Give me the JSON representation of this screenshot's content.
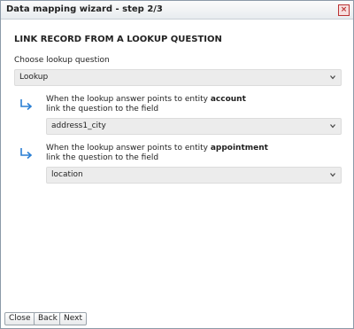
{
  "window": {
    "title": "Data mapping wizard - step 2/3",
    "close_label": "×"
  },
  "main": {
    "heading": "LINK RECORD FROM A LOOKUP QUESTION",
    "choose_label": "Choose lookup question",
    "lookup_select_value": "Lookup",
    "mappings": [
      {
        "line1_prefix": "When the lookup answer points to entity ",
        "entity": "account",
        "line2": "link the question to the field",
        "field_value": "address1_city"
      },
      {
        "line1_prefix": "When the lookup answer points to entity ",
        "entity": "appointment",
        "line2": "link the question to the field",
        "field_value": "location"
      }
    ]
  },
  "footer": {
    "close_label": "Close",
    "back_label": "Back",
    "next_label": "Next"
  },
  "colors": {
    "arrow": "#2a7fd4",
    "select_bg": "#ececec"
  },
  "icons": [
    "close-icon",
    "chevron-down-icon",
    "return-arrow-icon"
  ]
}
